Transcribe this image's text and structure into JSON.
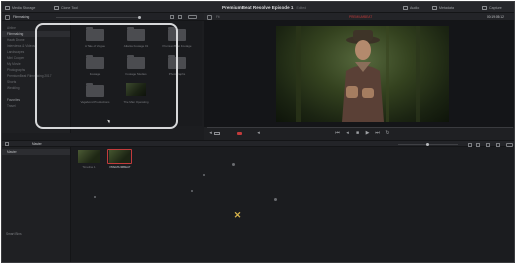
{
  "topbar": {
    "media_storage": "Media Storage",
    "clone_tool": "Clone Tool",
    "project_title": "PremiumBeat Resolve Episode 1",
    "project_status": "Edited",
    "audio": "Audio",
    "metadata": "Metadata",
    "capture": "Capture"
  },
  "library": {
    "header": "Filmmaking",
    "items": [
      "Airline",
      "Filmmaking",
      "Hawk Drone",
      "Interviews & Videos",
      "Landscapes",
      "Mini Cooper",
      "My Movie",
      "Photographs",
      "PremiumBeat Filmmaking 2017",
      "Shorts",
      "Wedding"
    ],
    "favorites_label": "Favorites",
    "favorites_item": "Travel"
  },
  "browser": {
    "items": [
      {
        "label": "A Tale of Vogue",
        "type": "folder"
      },
      {
        "label": "Atlanta Footage 01",
        "type": "folder"
      },
      {
        "label": "PremiumBeat Footage",
        "type": "folder"
      },
      {
        "label": "Footage",
        "type": "folder"
      },
      {
        "label": "Footage Studies",
        "type": "folder"
      },
      {
        "label": "Photographs",
        "type": "folder"
      },
      {
        "label": "Vagabond Productions",
        "type": "folder"
      },
      {
        "label": "The Man Operating",
        "type": "clip"
      }
    ]
  },
  "viewer": {
    "zoom": "Fit",
    "clip_name": "PREMIUMBEAT",
    "timecode": "00:19:05:12"
  },
  "media_pool": {
    "label": "Master",
    "bin_master": "Master",
    "smart_bins": "Smart Bins",
    "clips": [
      {
        "label": "Timeline 1"
      },
      {
        "label": "PREMIUMBEAT"
      }
    ]
  },
  "colors": {
    "accent_red": "#c23b3b",
    "highlight": "#d7d8da",
    "cursor": "#d6b24a"
  }
}
